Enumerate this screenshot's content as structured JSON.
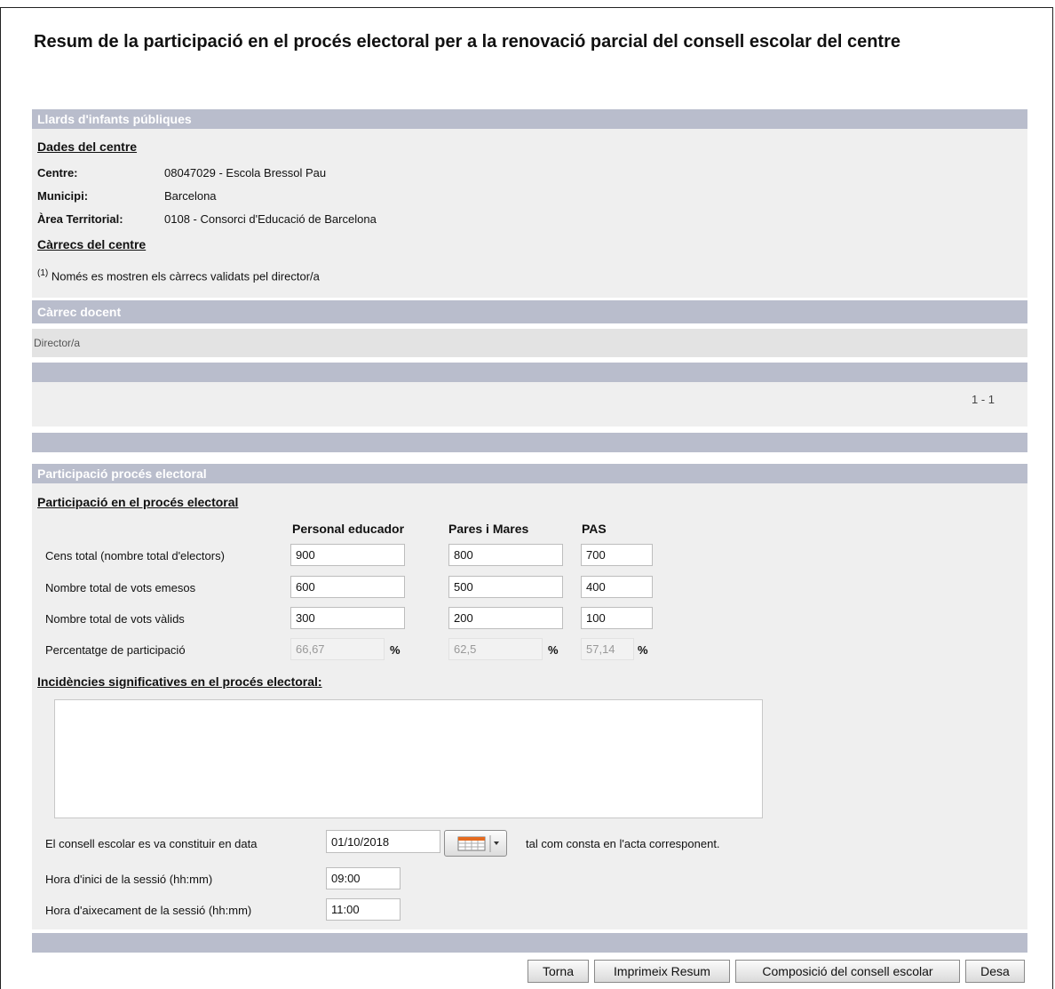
{
  "page": {
    "title": "Resum de la participació en el procés electoral per a la renovació parcial del consell escolar del centre"
  },
  "colors": {
    "section_bar": "#b9bdcc",
    "panel": "#efefef",
    "row_bg": "#e3e3e3"
  },
  "centre_section": {
    "header": "Llards d'infants públiques",
    "dades_title": "Dades del centre",
    "fields": [
      {
        "label": "Centre:",
        "value": "08047029 - Escola Bressol Pau"
      },
      {
        "label": "Municipi:",
        "value": "Barcelona"
      },
      {
        "label": "Àrea Territorial:",
        "value": "0108 - Consorci d'Educació de Barcelona"
      }
    ],
    "carrecs_title": "Càrrecs del centre",
    "note_mark": "(1)",
    "note_text": "Només es mostren els càrrecs validats pel director/a"
  },
  "carrec_section": {
    "header": "Càrrec docent",
    "rows": [
      "Director/a"
    ],
    "pagination": "1 - 1"
  },
  "participacio_section": {
    "header": "Participació procés electoral",
    "subtitle": "Participació en el procés electoral",
    "columns": [
      "Personal educador",
      "Pares i Mares",
      "PAS"
    ],
    "rows": [
      {
        "label": "Cens total (nombre total d'electors)",
        "values": [
          "900",
          "800",
          "700"
        ]
      },
      {
        "label": "Nombre total de vots emesos",
        "values": [
          "600",
          "500",
          "400"
        ]
      },
      {
        "label": "Nombre total de vots vàlids",
        "values": [
          "300",
          "200",
          "100"
        ]
      },
      {
        "label": "Percentatge de participació",
        "values": [
          "66,67",
          "62,5",
          "57,14"
        ],
        "unit": "%"
      }
    ],
    "incidencies_title": "Incidències significatives en el procés electoral:",
    "incidencies_value": "",
    "constitucio_label": "El consell escolar es va constituir en data",
    "constitucio_date": "01/10/2018",
    "constitucio_suffix": "tal com consta en l'acta corresponent.",
    "hora_inici_label": "Hora d'inici de la sessió (hh:mm)",
    "hora_inici": "09:00",
    "hora_fi_label": "Hora d'aixecament de la sessió (hh:mm)",
    "hora_fi": "11:00",
    "calendar_icon": "calendar-icon"
  },
  "buttons": {
    "torna": "Torna",
    "imprimeix": "Imprimeix Resum",
    "composicio": "Composició del consell escolar",
    "desa": "Desa"
  }
}
